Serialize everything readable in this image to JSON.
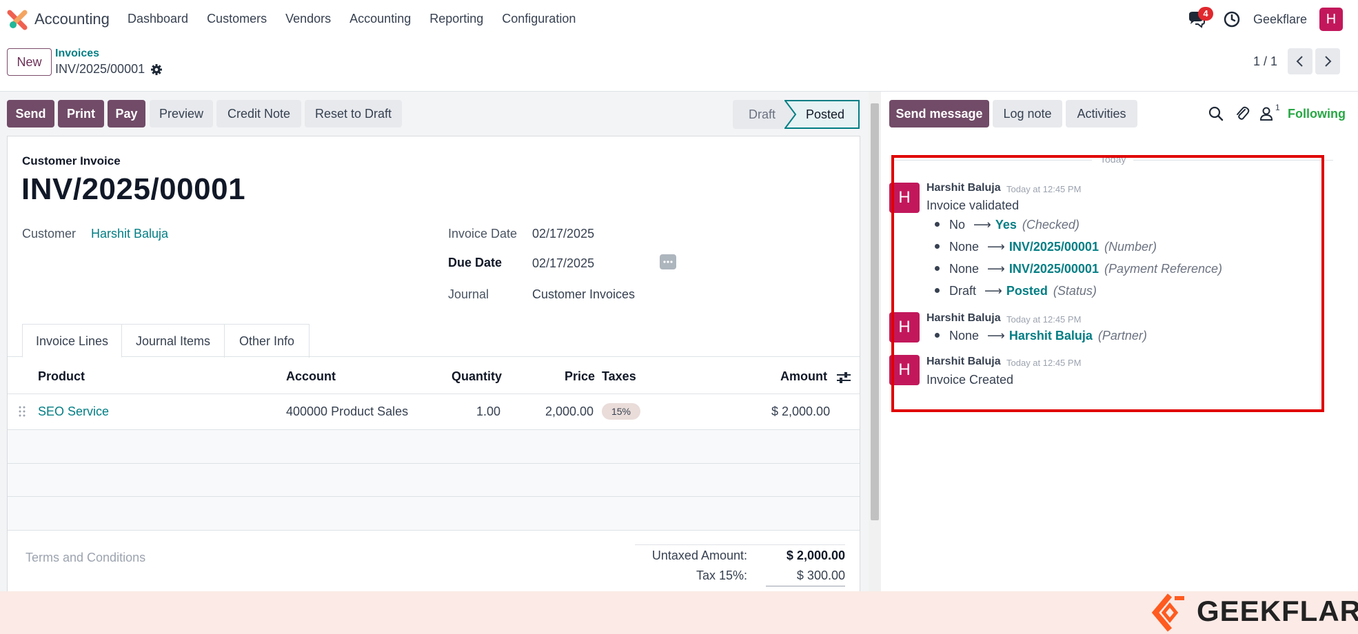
{
  "app": {
    "name": "Accounting",
    "nav": [
      "Dashboard",
      "Customers",
      "Vendors",
      "Accounting",
      "Reporting",
      "Configuration"
    ],
    "message_count": "4",
    "company": "Geekflare",
    "user_initial": "H"
  },
  "control": {
    "new_label": "New",
    "breadcrumb_parent": "Invoices",
    "breadcrumb_current": "INV/2025/00001",
    "pager": "1 / 1"
  },
  "actions": {
    "send": "Send",
    "print": "Print",
    "pay": "Pay",
    "preview": "Preview",
    "credit_note": "Credit Note",
    "reset": "Reset to Draft"
  },
  "status": {
    "draft": "Draft",
    "posted": "Posted"
  },
  "invoice": {
    "type": "Customer Invoice",
    "number": "INV/2025/00001",
    "customer_label": "Customer",
    "customer": "Harshit Baluja",
    "invoice_date_label": "Invoice Date",
    "invoice_date": "02/17/2025",
    "due_date_label": "Due Date",
    "due_date": "02/17/2025",
    "journal_label": "Journal",
    "journal": "Customer Invoices"
  },
  "tabs": [
    "Invoice Lines",
    "Journal Items",
    "Other Info"
  ],
  "lines": {
    "headers": [
      "Product",
      "Account",
      "Quantity",
      "Price",
      "Taxes",
      "Amount"
    ],
    "rows": [
      {
        "product": "SEO Service",
        "account": "400000 Product Sales",
        "quantity": "1.00",
        "price": "2,000.00",
        "tax": "15%",
        "amount": "$ 2,000.00"
      }
    ]
  },
  "totals": {
    "terms_placeholder": "Terms and Conditions",
    "untaxed_label": "Untaxed Amount:",
    "untaxed": "$ 2,000.00",
    "tax_label": "Tax 15%:",
    "tax": "$ 300.00"
  },
  "chatter": {
    "send_message": "Send message",
    "log_note": "Log note",
    "activities": "Activities",
    "followers": "1",
    "following": "Following",
    "today": "Today",
    "messages": [
      {
        "author": "Harshit Baluja",
        "time": "Today at 12:45 PM",
        "body": "Invoice validated",
        "tracking": [
          {
            "old": "No",
            "new": "Yes",
            "field": "(Checked)"
          },
          {
            "old": "None",
            "new": "INV/2025/00001",
            "field": "(Number)"
          },
          {
            "old": "None",
            "new": "INV/2025/00001",
            "field": "(Payment Reference)"
          },
          {
            "old": "Draft",
            "new": "Posted",
            "field": "(Status)"
          }
        ]
      },
      {
        "author": "Harshit Baluja",
        "time": "Today at 12:45 PM",
        "body": "",
        "tracking": [
          {
            "old": "None",
            "new": "Harshit Baluja",
            "field": "(Partner)"
          }
        ]
      },
      {
        "author": "Harshit Baluja",
        "time": "Today at 12:45 PM",
        "body": "Invoice Created",
        "tracking": []
      }
    ]
  },
  "watermark": "GEEKFLARE",
  "colors": {
    "primary": "#714b67",
    "link": "#017e84",
    "avatar": "#c2185b",
    "following": "#28a745",
    "highlight": "#e00000"
  }
}
